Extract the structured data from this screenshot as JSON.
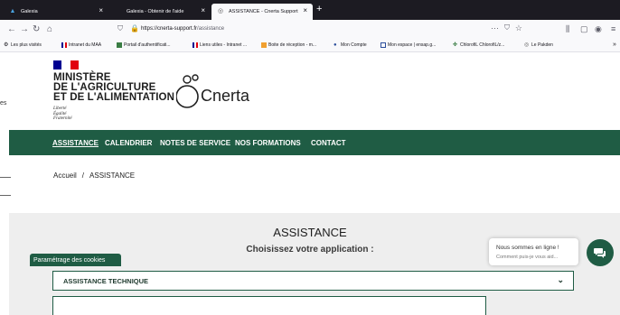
{
  "browser": {
    "tabs": [
      {
        "title": "Galexia",
        "icon": "galexia-icon"
      },
      {
        "title": "Galexia - Obtenir de l'aide",
        "icon": "page-icon"
      },
      {
        "title": "ASSISTANCE - Cnerta Support",
        "icon": "cnerta-tab-icon"
      }
    ],
    "new_tab": "+",
    "url_host": "https://cnerta-support.fr",
    "url_path": "/assistance",
    "bookmarks": [
      {
        "label": "Les plus visités",
        "icon": "gear-icon"
      },
      {
        "label": "Intranet du MAA",
        "icon": "flag-icon"
      },
      {
        "label": "Portail d'authentificati...",
        "icon": "portal-icon"
      },
      {
        "label": "Liens utiles - Intranet ...",
        "icon": "flag-icon"
      },
      {
        "label": "Boite de réception - m...",
        "icon": "mail-icon"
      },
      {
        "label": "Mon Compte",
        "icon": "account-icon"
      },
      {
        "label": "Mon espace | ensap.g...",
        "icon": "ensap-icon"
      },
      {
        "label": "ChlorofiL ChlorofiL/z...",
        "icon": "chlorofil-icon"
      },
      {
        "label": "Le Pakden",
        "icon": "globe-icon"
      }
    ]
  },
  "page": {
    "side_fragment": "es",
    "ministry_lines": [
      "MINISTÈRE",
      "DE L'AGRICULTURE",
      "ET DE L'ALIMENTATION"
    ],
    "motto_lines": [
      "Liberté",
      "Égalité",
      "Fraternité"
    ],
    "brand": "Cnerta",
    "menu": [
      {
        "label": "ASSISTANCE",
        "current": true
      },
      {
        "label": "CALENDRIER"
      },
      {
        "label": "NOTES DE SERVICE"
      },
      {
        "label": "NOS FORMATIONS"
      },
      {
        "label": "CONTACT"
      }
    ],
    "breadcrumb": {
      "home": "Accueil",
      "sep": "/",
      "current": "ASSISTANCE"
    },
    "assistance_title": "ASSISTANCE",
    "assistance_subtitle": "Choisissez votre application :",
    "select_label": "ASSISTANCE TECHNIQUE",
    "cookies_label": "Paramétrage des cookies",
    "chat": {
      "line1": "Nous sommes en ligne !",
      "line2": "Comment puis-je vous aid..."
    }
  },
  "colors": {
    "brand_green": "#1f5c44",
    "tabbar": "#1c1b22",
    "panel": "#eeeeee",
    "flag_blue": "#000091",
    "flag_red": "#e1000f"
  }
}
